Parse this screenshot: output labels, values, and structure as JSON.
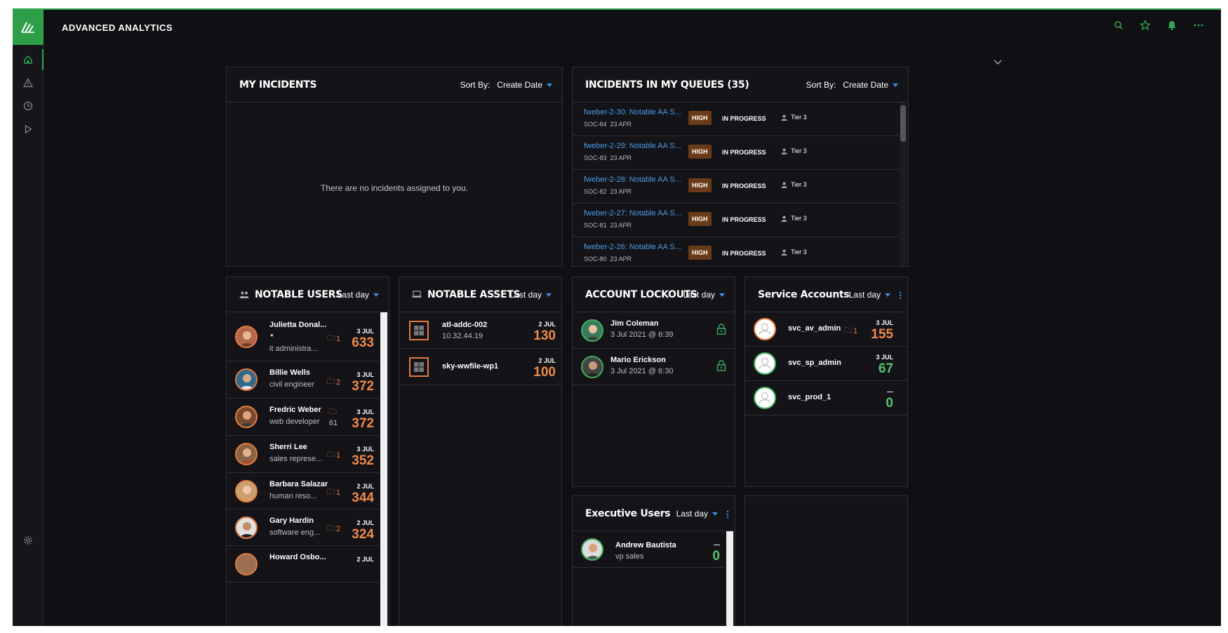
{
  "app": {
    "title": "ADVANCED ANALYTICS"
  },
  "colors": {
    "accent": "#2fa84f",
    "link": "#4e9be6",
    "score": "#f08a4a",
    "high_badge": "#6a3b18"
  },
  "sidebar": {
    "items": [
      {
        "icon": "home-icon"
      },
      {
        "icon": "alert-icon"
      },
      {
        "icon": "clock-icon"
      },
      {
        "icon": "play-icon"
      },
      {
        "icon": "gear-icon"
      }
    ]
  },
  "topbar": {
    "icons": [
      "search-icon",
      "star-icon",
      "bell-icon",
      "more-icon"
    ]
  },
  "my_incidents": {
    "title": "MY INCIDENTS",
    "sort_label": "Sort By:",
    "sort_value": "Create Date",
    "empty_message": "There are no incidents assigned to you."
  },
  "queues": {
    "title": "INCIDENTS IN MY QUEUES (35)",
    "sort_label": "Sort By:",
    "sort_value": "Create Date",
    "rows": [
      {
        "name": "fweber-2-30: Notable AA S...",
        "id": "SOC-84",
        "date": "23 APR",
        "priority": "HIGH",
        "status": "IN PROGRESS",
        "tier": "Tier 3"
      },
      {
        "name": "fweber-2-29: Notable AA S...",
        "id": "SOC-83",
        "date": "23 APR",
        "priority": "HIGH",
        "status": "IN PROGRESS",
        "tier": "Tier 3"
      },
      {
        "name": "fweber-2-28: Notable AA S...",
        "id": "SOC-82",
        "date": "23 APR",
        "priority": "HIGH",
        "status": "IN PROGRESS",
        "tier": "Tier 3"
      },
      {
        "name": "fweber-2-27: Notable AA S...",
        "id": "SOC-81",
        "date": "23 APR",
        "priority": "HIGH",
        "status": "IN PROGRESS",
        "tier": "Tier 3"
      },
      {
        "name": "fweber-2-26: Notable AA S...",
        "id": "SOC-80",
        "date": "23 APR",
        "priority": "HIGH",
        "status": "IN PROGRESS",
        "tier": "Tier 3"
      }
    ]
  },
  "notable_users": {
    "title": "NOTABLE USERS",
    "range": "Last day",
    "rows": [
      {
        "name": "Julietta Donal...",
        "role": "it administra...",
        "count": "1",
        "date": "3 JUL",
        "score": "633"
      },
      {
        "name": "Billie Wells",
        "role": "civil engineer",
        "count": "2",
        "date": "3 JUL",
        "score": "372"
      },
      {
        "name": "Fredric Weber",
        "role": "web developer",
        "count": "61",
        "date": "3 JUL",
        "score": "372"
      },
      {
        "name": "Sherri Lee",
        "role": "sales represe...",
        "count": "1",
        "date": "3 JUL",
        "score": "352"
      },
      {
        "name": "Barbara Salazar",
        "role": "human reso...",
        "count": "1",
        "date": "2 JUL",
        "score": "344"
      },
      {
        "name": "Gary Hardin",
        "role": "software eng...",
        "count": "2",
        "date": "2 JUL",
        "score": "324"
      },
      {
        "name": "Howard Osbo...",
        "role": "",
        "count": "",
        "date": "2 JUL",
        "score": ""
      }
    ]
  },
  "notable_assets": {
    "title": "NOTABLE ASSETS",
    "range": "Last day",
    "rows": [
      {
        "name": "atl-addc-002",
        "ip": "10.32.44.19",
        "date": "2 JUL",
        "score": "130"
      },
      {
        "name": "sky-wwfile-wp1",
        "ip": "",
        "date": "2 JUL",
        "score": "100"
      }
    ]
  },
  "lockouts": {
    "title": "ACCOUNT LOCKOUTS",
    "range": "Last day",
    "rows": [
      {
        "name": "Jim Coleman",
        "time": "3 Jul 2021 @ 6:39"
      },
      {
        "name": "Mario Erickson",
        "time": "3 Jul 2021 @ 6:30"
      }
    ]
  },
  "service_accounts": {
    "title": "Service Accounts",
    "range": "Last day",
    "rows": [
      {
        "name": "svc_av_admin",
        "count": "1",
        "date": "3 JUL",
        "score": "155",
        "score_color": "orange"
      },
      {
        "name": "svc_sp_admin",
        "count": "",
        "date": "3 JUL",
        "score": "67",
        "score_color": "green"
      },
      {
        "name": "svc_prod_1",
        "count": "",
        "date": "—",
        "score": "0",
        "score_color": "green"
      }
    ]
  },
  "executive_users": {
    "title": "Executive Users",
    "range": "Last day",
    "rows": [
      {
        "name": "Andrew Bautista",
        "role": "vp sales",
        "date": "—",
        "score": "0"
      }
    ]
  }
}
